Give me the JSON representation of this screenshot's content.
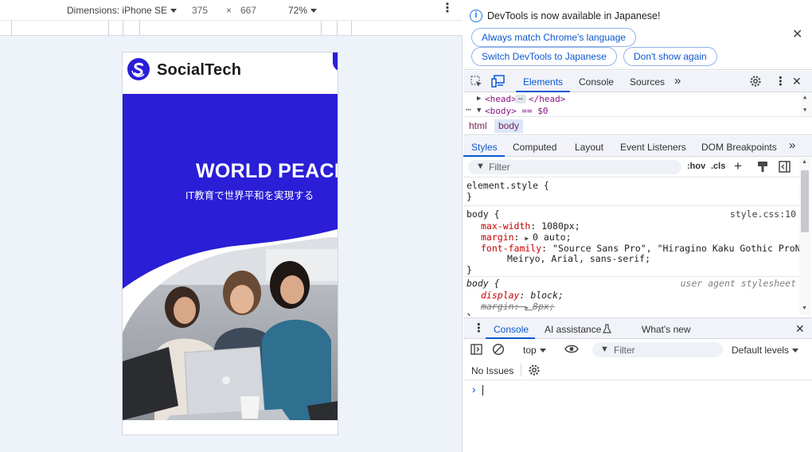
{
  "emulation": {
    "device_label": "Dimensions: iPhone SE",
    "width": "375",
    "times": "×",
    "height": "667",
    "zoom": "72%"
  },
  "site": {
    "logo_text": "SocialTech",
    "hero_title": "WORLD PEACE",
    "hero_subtitle": "IT教育で世界平和を実現する",
    "brand_color": "#2a1ed6"
  },
  "infobar": {
    "message": "DevTools is now available in Japanese!",
    "btn_match": "Always match Chrome's language",
    "btn_switch": "Switch DevTools to Japanese",
    "btn_dont_show": "Don't show again"
  },
  "main_tabs": [
    "Elements",
    "Console",
    "Sources"
  ],
  "dom_tree": {
    "head_open": "<head>",
    "head_close": "</head>",
    "body_line": "<body> == $0"
  },
  "breadcrumbs": [
    "html",
    "body"
  ],
  "sub_tabs": [
    "Styles",
    "Computed",
    "Layout",
    "Event Listeners",
    "DOM Breakpoints"
  ],
  "styles_filter": {
    "placeholder": "Filter",
    "hov": ":hov",
    "cls": ".cls"
  },
  "rules": {
    "element_style": {
      "selector": "element.style {",
      "close": "}"
    },
    "body_rule": {
      "selector": "body {",
      "source": "style.css:10",
      "decl1_prop": "max-width",
      "decl1_val": "1080px;",
      "decl2_prop": "margin",
      "decl2_val": "0 auto;",
      "decl3_prop": "font-family",
      "decl3_val": "\"Source Sans Pro\", \"Hiragino Kaku Gothic ProN\",",
      "decl3_val2": "Meiryo, Arial, sans-serif;",
      "close": "}"
    },
    "ua_rule": {
      "selector": "body {",
      "source": "user agent stylesheet",
      "decl1_prop": "display",
      "decl1_val": "block;",
      "decl2_prop": "margin",
      "decl2_val": "8px;",
      "close": "}"
    }
  },
  "drawer": {
    "tabs": [
      "Console",
      "AI assistance",
      "What's new"
    ],
    "context": "top",
    "filter_placeholder": "Filter",
    "levels": "Default levels",
    "issues": "No Issues",
    "prompt": "›"
  }
}
